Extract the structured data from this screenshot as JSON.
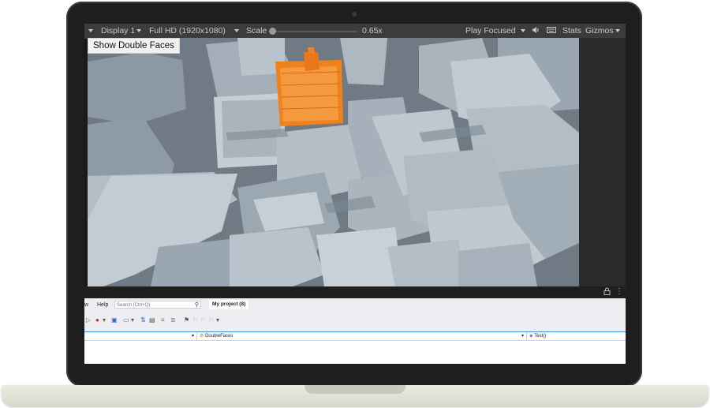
{
  "game_toolbar": {
    "display": "Display 1",
    "resolution": "Full HD (1920x1080)",
    "scale_label": "Scale",
    "scale_value": "0.65x",
    "play_mode": "Play Focused",
    "stats": "Stats",
    "gizmos": "Gizmos",
    "icons": [
      "caret-down-icon",
      "speaker-icon",
      "keyboard-icon"
    ]
  },
  "viewport": {
    "overlay_button": "Show Double Faces",
    "highlight_color": "#f0821e",
    "building_color": "#9aa6b1"
  },
  "status_icons": [
    "lock-icon",
    "more-vert-icon"
  ],
  "visual_studio": {
    "menu_fragment": "w",
    "menu_help": "Help",
    "search_placeholder": "Search (Ctrl+Q)",
    "project_tab": "My project (8)",
    "nav_class": "DoubleFaces",
    "nav_method": "Test()"
  }
}
